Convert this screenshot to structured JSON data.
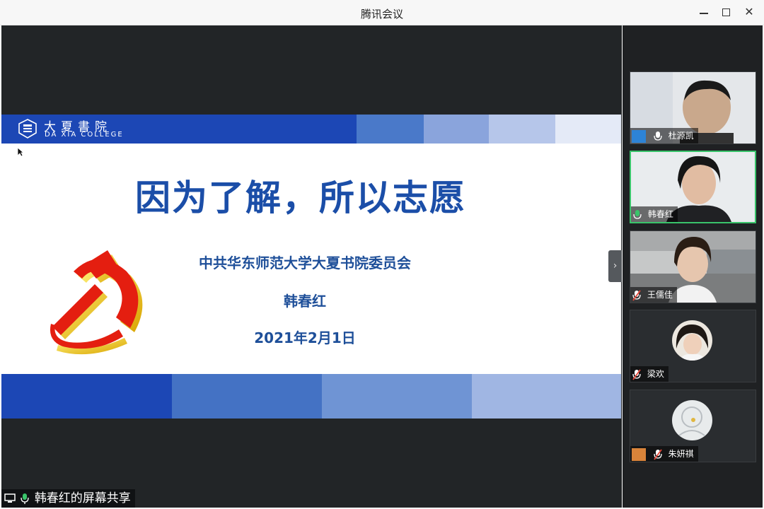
{
  "window": {
    "title": "腾讯会议",
    "close_symbol": "✕"
  },
  "slide": {
    "logo_cn": "大夏書院",
    "logo_en": "DA XIA COLLEGE",
    "title": "因为了解，所以志愿",
    "org": "中共华东师范大学大夏书院委员会",
    "presenter": "韩春红",
    "date": "2021年2月1日",
    "colors": {
      "title": "#1b4ea8",
      "band_dark": "#1c47b5"
    }
  },
  "share_label": "韩春红的屏幕共享",
  "collapse_symbol": "›",
  "participants": [
    {
      "name": "杜源凯",
      "mic": "on",
      "icon": "person-avatar-icon"
    },
    {
      "name": "韩春红",
      "mic": "on",
      "active": true
    },
    {
      "name": "王儒佳",
      "mic": "muted"
    },
    {
      "name": "梁欢",
      "mic": "muted"
    },
    {
      "name": "朱妍祺",
      "mic": "muted",
      "icon": "person-avatar-icon"
    }
  ]
}
